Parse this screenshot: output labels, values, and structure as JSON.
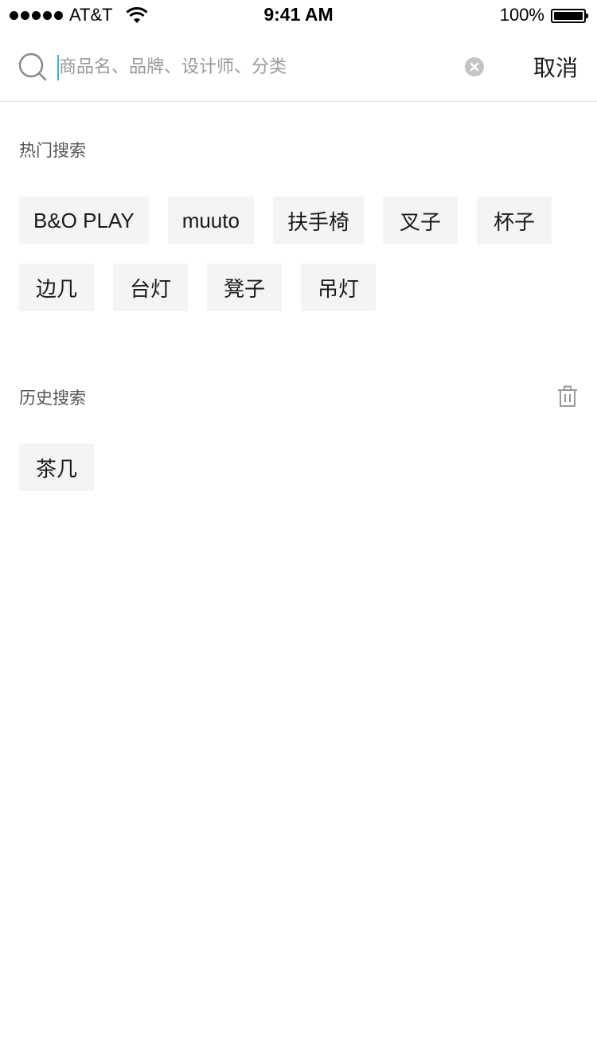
{
  "status_bar": {
    "carrier": "AT&T",
    "time": "9:41 AM",
    "battery": "100%",
    "battery_level": 1.0,
    "signal_bars": 5
  },
  "search": {
    "placeholder": "商品名、品牌、设计师、分类",
    "value": "",
    "cancel_label": "取消",
    "icons": {
      "search": "search-icon",
      "clear": "clear-icon"
    },
    "cursor_color": "#35b7c7"
  },
  "hot": {
    "title": "热门搜索",
    "tags": [
      "B&O PLAY",
      "muuto",
      "扶手椅",
      "叉子",
      "杯子",
      "边几",
      "台灯",
      "凳子",
      "吊灯"
    ]
  },
  "history": {
    "title": "历史搜索",
    "delete_icon": "trash-icon",
    "tags": [
      "茶几"
    ]
  }
}
